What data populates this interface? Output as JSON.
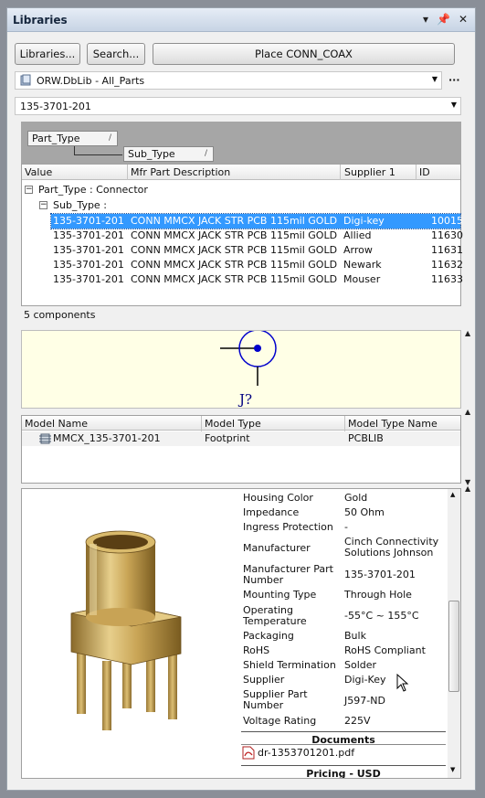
{
  "panel": {
    "title": "Libraries"
  },
  "toolbar": {
    "libraries_label": "Libraries...",
    "search_label": "Search...",
    "place_label": "Place CONN_COAX"
  },
  "library_select": {
    "value": "ORW.DbLib - All_Parts"
  },
  "filter_combo": {
    "value": "135-3701-201"
  },
  "grouping": {
    "chip1": "Part_Type",
    "chip2": "Sub_Type"
  },
  "grid": {
    "columns": [
      "Value",
      "Mfr Part Description",
      "Supplier 1",
      "ID"
    ],
    "group1": "Part_Type : Connector",
    "group2": "Sub_Type :",
    "rows": [
      {
        "value": "135-3701-201",
        "desc": "CONN MMCX JACK STR PCB 115mil GOLD",
        "supplier": "Digi-key",
        "id": "10015"
      },
      {
        "value": "135-3701-201",
        "desc": "CONN MMCX JACK STR PCB 115mil GOLD",
        "supplier": "Allied",
        "id": "11630"
      },
      {
        "value": "135-3701-201",
        "desc": "CONN MMCX JACK STR PCB 115mil GOLD",
        "supplier": "Arrow",
        "id": "11631"
      },
      {
        "value": "135-3701-201",
        "desc": "CONN MMCX JACK STR PCB 115mil GOLD",
        "supplier": "Newark",
        "id": "11632"
      },
      {
        "value": "135-3701-201",
        "desc": "CONN MMCX JACK STR PCB 115mil GOLD",
        "supplier": "Mouser",
        "id": "11633"
      }
    ]
  },
  "status": {
    "count": "5 components"
  },
  "symbol": {
    "designator": "J?"
  },
  "models": {
    "columns": [
      "Model Name",
      "Model Type",
      "Model Type Name"
    ],
    "rows": [
      {
        "name": "MMCX_135-3701-201",
        "type": "Footprint",
        "type_name": "PCBLIB"
      }
    ]
  },
  "properties": {
    "items": [
      {
        "label": "Housing Color",
        "value": "Gold"
      },
      {
        "label": "Impedance",
        "value": "50 Ohm"
      },
      {
        "label": "Ingress Protection",
        "value": "-"
      },
      {
        "label": "Manufacturer",
        "value": "Cinch Connectivity Solutions Johnson"
      },
      {
        "label": "Manufacturer Part Number",
        "value": "135-3701-201"
      },
      {
        "label": "Mounting Type",
        "value": "Through Hole"
      },
      {
        "label": "Operating Temperature",
        "value": "-55°C ~ 155°C"
      },
      {
        "label": "Packaging",
        "value": "Bulk"
      },
      {
        "label": "RoHS",
        "value": "RoHS Compliant"
      },
      {
        "label": "Shield Termination",
        "value": "Solder"
      },
      {
        "label": "Supplier",
        "value": "Digi-Key"
      },
      {
        "label": "Supplier Part Number",
        "value": "J597-ND"
      },
      {
        "label": "Voltage Rating",
        "value": "225V"
      }
    ],
    "documents_title": "Documents",
    "document_file": "dr-1353701201.pdf",
    "pricing_title": "Pricing - USD"
  },
  "colors": {
    "selection": "#3399ff",
    "symbol_blue": "#0000cc",
    "symbol_bg": "#ffffe6"
  }
}
